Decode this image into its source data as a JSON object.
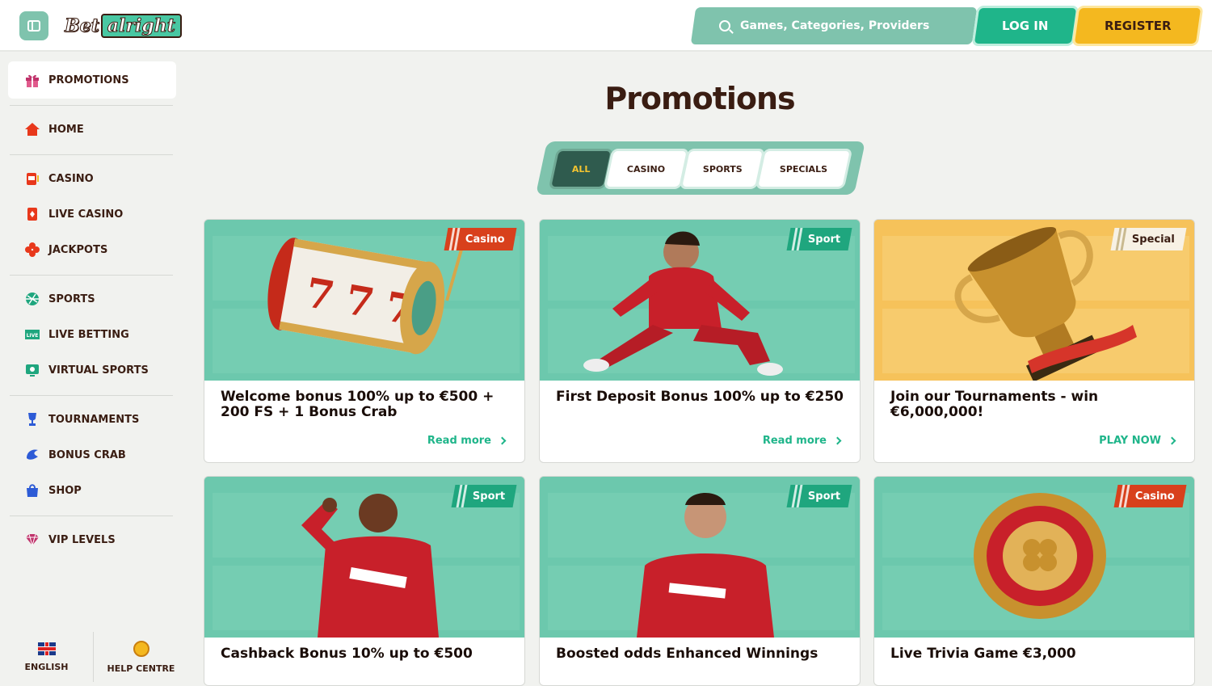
{
  "header": {
    "logo_part1": "Bet",
    "logo_part2": "alright",
    "search_placeholder": "Games, Categories, Providers",
    "login_label": "LOG IN",
    "register_label": "REGISTER"
  },
  "sidebar": {
    "promotions": "PROMOTIONS",
    "home": "HOME",
    "casino": "CASINO",
    "live_casino": "LIVE CASINO",
    "jackpots": "JACKPOTS",
    "sports": "SPORTS",
    "live_betting": "LIVE BETTING",
    "virtual_sports": "VIRTUAL SPORTS",
    "tournaments": "TOURNAMENTS",
    "bonus_crab": "BONUS CRAB",
    "shop": "SHOP",
    "vip_levels": "VIP LEVELS",
    "language": "ENGLISH",
    "help": "HELP CENTRE"
  },
  "main": {
    "title": "Promotions",
    "tabs": [
      "ALL",
      "CASINO",
      "SPORTS",
      "SPECIALS"
    ],
    "cards": [
      {
        "badge": "Casino",
        "title": "Welcome bonus 100% up to €500 + 200 FS + 1 Bonus Crab",
        "link": "Read more"
      },
      {
        "badge": "Sport",
        "title": "First Deposit Bonus 100% up to €250",
        "link": "Read more"
      },
      {
        "badge": "Special",
        "title": "Join our Tournaments - win €6,000,000!",
        "link": "PLAY NOW"
      },
      {
        "badge": "Sport",
        "title": "Cashback Bonus 10% up to €500"
      },
      {
        "badge": "Sport",
        "title": "Boosted odds Enhanced Winnings"
      },
      {
        "badge": "Casino",
        "title": "Live Trivia Game €3,000"
      }
    ]
  },
  "colors": {
    "accent_green": "#1fb58a",
    "mint": "#7fc3ad",
    "yellow": "#f4b81f",
    "brown": "#3a1d12",
    "casino_red": "#d8401c"
  }
}
